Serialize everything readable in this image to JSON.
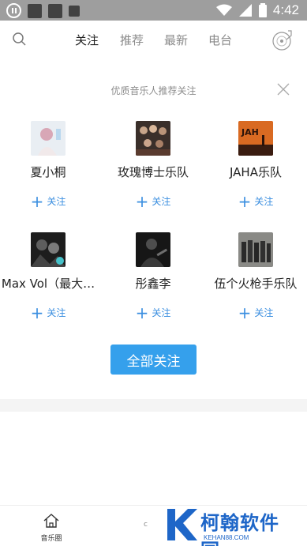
{
  "status_bar": {
    "time": "4:42"
  },
  "nav": {
    "tabs": [
      {
        "label": "关注",
        "active": true
      },
      {
        "label": "推荐",
        "active": false
      },
      {
        "label": "最新",
        "active": false
      },
      {
        "label": "电台",
        "active": false
      }
    ]
  },
  "recommend": {
    "title": "优质音乐人推荐关注",
    "follow_label": "关注",
    "artists": [
      {
        "name": "夏小桐"
      },
      {
        "name": "玫瑰博士乐队"
      },
      {
        "name": "JAHA乐队"
      },
      {
        "name": "Max Vol（最大…"
      },
      {
        "name": "彤鑫李"
      },
      {
        "name": "伍个火枪手乐队"
      }
    ],
    "follow_all_label": "全部关注"
  },
  "bottom_bar": {
    "home_label": "音乐圈",
    "mid_glyph": "c"
  },
  "watermark": {
    "text": "柯翰软件园",
    "sub": "KEHAN88.COM",
    "logo_letter": "K"
  },
  "colors": {
    "accent": "#35a0ec",
    "follow": "#3b8fe0",
    "statusbar": "#9e9e9e"
  }
}
